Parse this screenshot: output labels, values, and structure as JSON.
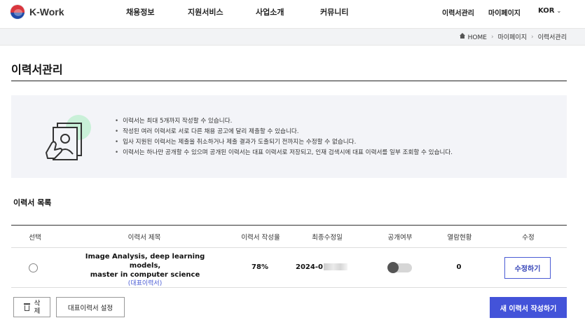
{
  "header": {
    "logo_text": "K-Work",
    "nav": [
      "채용정보",
      "지원서비스",
      "사업소개",
      "커뮤니티"
    ],
    "util": {
      "resume_manage": "이력서관리",
      "mypage": "마이페이지",
      "lang": "KOR"
    }
  },
  "breadcrumb": [
    "HOME",
    "마이페이지",
    "이력서관리"
  ],
  "page_title": "이력서관리",
  "info": [
    "이력서는 최대 5개까지 작성할 수 있습니다.",
    "작성된 여러 이력서로 서로 다른 채용 공고에 달리 제출할 수 있습니다.",
    "입사 지원된 이력서는 제출을 취소하거나 제출 결과가 도출되기 전까지는 수정할 수 없습니다.",
    "이력서는 하나만 공개할 수 있으며 공개된 이력서는 대표 이력서로 저장되고, 인재 검색시에 대표 이력서를 일부 조회할 수 있습니다."
  ],
  "list_title": "이력서 목록",
  "table": {
    "headers": [
      "선택",
      "이력서 제목",
      "이력서 작성율",
      "최종수정일",
      "공개여부",
      "열람현황",
      "수정"
    ],
    "rows": [
      {
        "title_line1": "Image Analysis, deep learning models,",
        "title_line2": "master in computer science",
        "tag": "(대표이력서)",
        "rate": "78%",
        "date": "2024-0",
        "public": false,
        "views": "0",
        "edit_label": "수정하기"
      }
    ]
  },
  "buttons": {
    "delete": "삭제",
    "set_rep": "대표이력서 설정",
    "new_resume": "새 이력서 작성하기"
  }
}
